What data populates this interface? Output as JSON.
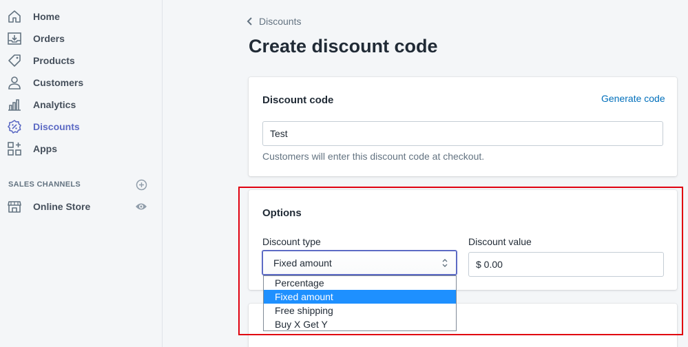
{
  "sidebar": {
    "items": [
      {
        "label": "Home",
        "icon": "home-icon"
      },
      {
        "label": "Orders",
        "icon": "orders-icon"
      },
      {
        "label": "Products",
        "icon": "tag-icon"
      },
      {
        "label": "Customers",
        "icon": "person-icon"
      },
      {
        "label": "Analytics",
        "icon": "bar-chart-icon"
      },
      {
        "label": "Discounts",
        "icon": "discount-icon",
        "active": true
      },
      {
        "label": "Apps",
        "icon": "apps-icon"
      }
    ],
    "sales_channels_title": "SALES CHANNELS",
    "channels": [
      {
        "label": "Online Store",
        "icon": "store-icon"
      }
    ]
  },
  "breadcrumb": {
    "label": "Discounts"
  },
  "page": {
    "title": "Create discount code"
  },
  "discount_code_card": {
    "title": "Discount code",
    "generate_link": "Generate code",
    "code_value": "Test",
    "help_text": "Customers will enter this discount code at checkout."
  },
  "options_card": {
    "title": "Options",
    "discount_type_label": "Discount type",
    "discount_type_selected": "Fixed amount",
    "discount_type_options": [
      "Percentage",
      "Fixed amount",
      "Free shipping",
      "Buy X Get Y"
    ],
    "discount_value_label": "Discount value",
    "discount_value": "$ 0.00"
  },
  "colors": {
    "accent": "#5c6ac4",
    "link": "#006fbb",
    "highlight": "#e0000f",
    "selected_option": "#1e90ff"
  }
}
